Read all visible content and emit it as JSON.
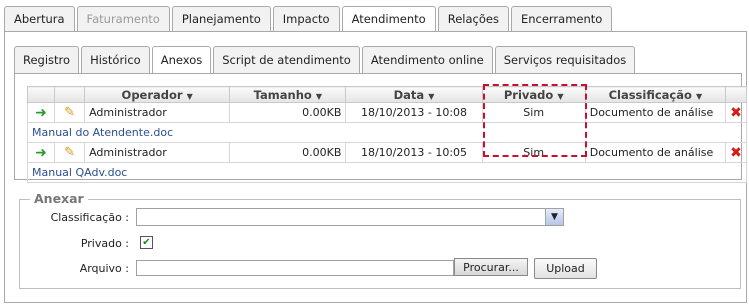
{
  "top_tabs": [
    {
      "label": "Abertura",
      "state": "normal"
    },
    {
      "label": "Faturamento",
      "state": "disabled"
    },
    {
      "label": "Planejamento",
      "state": "normal"
    },
    {
      "label": "Impacto",
      "state": "normal"
    },
    {
      "label": "Atendimento",
      "state": "active"
    },
    {
      "label": "Relações",
      "state": "normal"
    },
    {
      "label": "Encerramento",
      "state": "normal"
    }
  ],
  "sub_tabs": [
    {
      "label": "Registro",
      "state": "normal"
    },
    {
      "label": "Histórico",
      "state": "normal"
    },
    {
      "label": "Anexos",
      "state": "active"
    },
    {
      "label": "Script de atendimento",
      "state": "normal"
    },
    {
      "label": "Atendimento online",
      "state": "normal"
    },
    {
      "label": "Serviços requisitados",
      "state": "normal"
    }
  ],
  "grid": {
    "headers": [
      "",
      "",
      "Operador",
      "Tamanho",
      "Data",
      "Privado",
      "Classificação",
      ""
    ],
    "rows": [
      {
        "operador": "Administrador",
        "tamanho": "0.00KB",
        "data": "18/10/2013 - 10:08",
        "privado": "Sim",
        "classificacao": "Documento de análise",
        "filename": "Manual do Atendente.doc"
      },
      {
        "operador": "Administrador",
        "tamanho": "0.00KB",
        "data": "18/10/2013 - 10:05",
        "privado": "Sim",
        "classificacao": "Documento de análise",
        "filename": "Manual QAdv.doc"
      }
    ]
  },
  "anexar": {
    "legend": "Anexar",
    "classificacao_label": "Classificação :",
    "classificacao_value": "",
    "privado_label": "Privado :",
    "privado_checked": true,
    "arquivo_label": "Arquivo :",
    "arquivo_value": "",
    "browse_label": "Procurar...",
    "upload_label": "Upload"
  },
  "colors": {
    "highlight": "#c8102e",
    "link": "#2a4f8f",
    "delete": "#d81a1a",
    "open": "#2e9a2e"
  }
}
